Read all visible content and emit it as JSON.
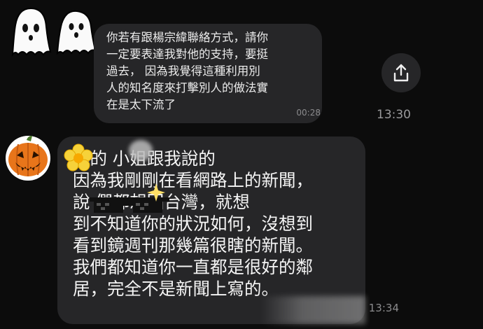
{
  "messages": [
    {
      "text": "你若有跟楊宗緯聯絡方式，請你\n一定要表達我對他的支持，要挺\n過去，  因為我覺得這種利用別\n人的知名度來打擊別人的做法實\n在是太下流了",
      "time": "00:28"
    },
    {
      "text": "  樓的  小姐跟我說的\n因為我剛剛在看網路上的新聞，\n說         們都想回台灣，就想\n到不知道你的狀況如何，沒想到\n看到鏡週刊那幾篇很瞎的新聞。\n我們都知道你一直都是很好的鄰\n居，完全不是新聞上寫的。",
      "time": "13:34"
    }
  ],
  "side_time": "13:30",
  "icons": {
    "ghost_left": "ghost-icon",
    "ghost_right": "ghost-icon",
    "pumpkin": "jack-o-lantern-icon",
    "share": "share-icon",
    "flower": "flower-sticker",
    "sunglasses": "pixel-sunglasses-sticker",
    "sparkle": "sparkle-icon"
  },
  "colors": {
    "background": "#0c0c0c",
    "bubble": "#262628",
    "text": "#f2f2f2",
    "timestamp": "#8b8b8d",
    "pumpkin": "#e8751a"
  }
}
